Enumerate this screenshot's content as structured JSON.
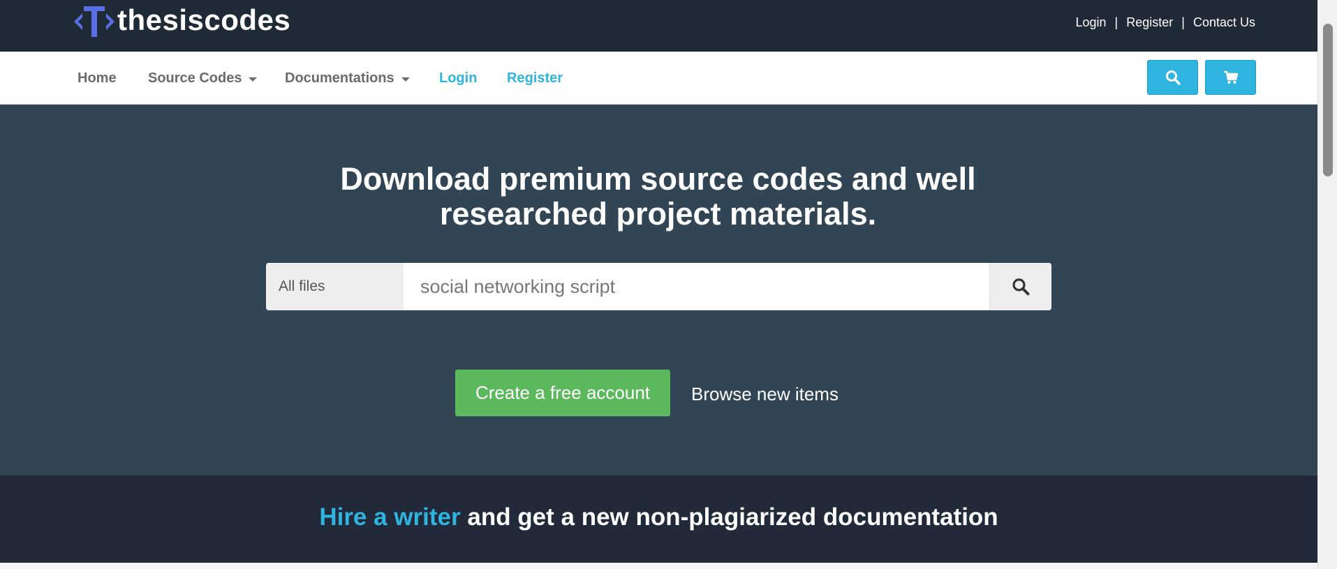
{
  "header": {
    "logo_text": "thesiscodes",
    "links": [
      "Login",
      "Register",
      "Contact Us"
    ],
    "separator": "|"
  },
  "nav": {
    "items": [
      {
        "label": "Home"
      },
      {
        "label": "Source Codes"
      },
      {
        "label": "Documentations"
      },
      {
        "label": "Login"
      },
      {
        "label": "Register"
      }
    ],
    "search_icon": "search-icon",
    "cart_icon": "cart-icon"
  },
  "hero": {
    "title": "Download premium source codes and well researched project materials.",
    "search_category": "All files",
    "search_placeholder": "social networking script",
    "cta_label": "Create a free account",
    "browse_label": "Browse new items"
  },
  "band": {
    "highlight": "Hire a writer",
    "rest": " and get a new non-plagiarized documentation"
  },
  "colors": {
    "topbar": "#1e2a36",
    "hero": "#324554",
    "accent": "#2fb3df",
    "green": "#5cb85c",
    "band": "#222938",
    "logo_blue": "#5a6fe6"
  }
}
